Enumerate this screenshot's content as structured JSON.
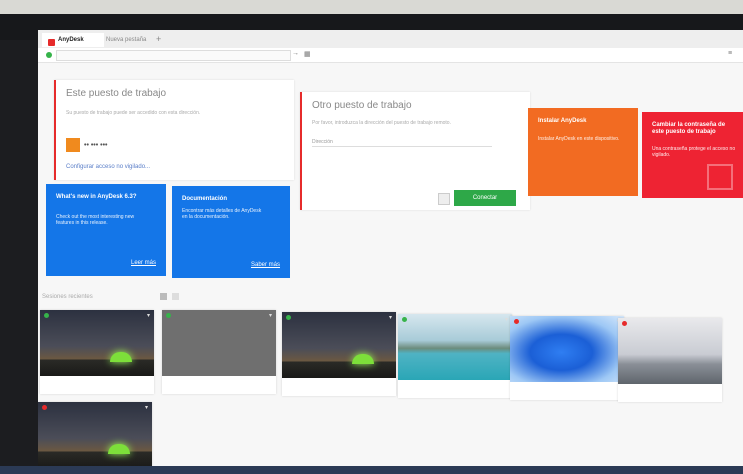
{
  "browser": {
    "tabs": [
      {
        "label": "AnyDesk",
        "active": true
      },
      {
        "label": "Nueva pestaña",
        "active": false
      }
    ],
    "address_placeholder": ""
  },
  "cards": {
    "this_desk": {
      "title": "Este puesto de trabajo",
      "description": "Su puesto de trabajo puede ser accedido con esta dirección.",
      "address": "•• ••• •••",
      "link": "Configurar acceso no vigilado..."
    },
    "remote_desk": {
      "title": "Otro puesto de trabajo",
      "description": "Por favor, introduzca la dirección del puesto de trabajo remoto.",
      "input_placeholder": "Dirección",
      "connect_label": "Conectar"
    }
  },
  "promos": [
    {
      "title": "Instalar AnyDesk",
      "text": "Instalar AnyDesk en este dispositivo.",
      "link": "",
      "color": "#f26b22"
    },
    {
      "title": "Cambiar la contraseña de este puesto de trabajo",
      "text": "Una contraseña protege el acceso no vigilado.",
      "link": "",
      "color": "#ee2333"
    },
    {
      "title": "What's new in AnyDesk 6.3?",
      "text": "Check out the most interesting new features in this release.",
      "link": "Leer más",
      "color": "#1476e8"
    },
    {
      "title": "Documentación",
      "text": "Encontrar más detalles de AnyDesk en la documentación.",
      "link": "Saber más",
      "color": "#1476e8"
    }
  ],
  "recent": {
    "header": "Sesiones recientes",
    "thumbnails": [
      {
        "caption": "",
        "status": "#36b34a"
      },
      {
        "caption": "",
        "status": "#36b34a",
        "overlay": ""
      },
      {
        "caption": "",
        "status": "#36b34a"
      },
      {
        "caption": "",
        "status": "#36b34a"
      },
      {
        "caption": "",
        "status": "#e62b2b"
      },
      {
        "caption": "",
        "status": "#e62b2b"
      },
      {
        "caption": "",
        "status": "#e62b2b"
      }
    ]
  },
  "colors": {
    "accent_red": "#e62b2b",
    "connect_green": "#2ea848"
  }
}
